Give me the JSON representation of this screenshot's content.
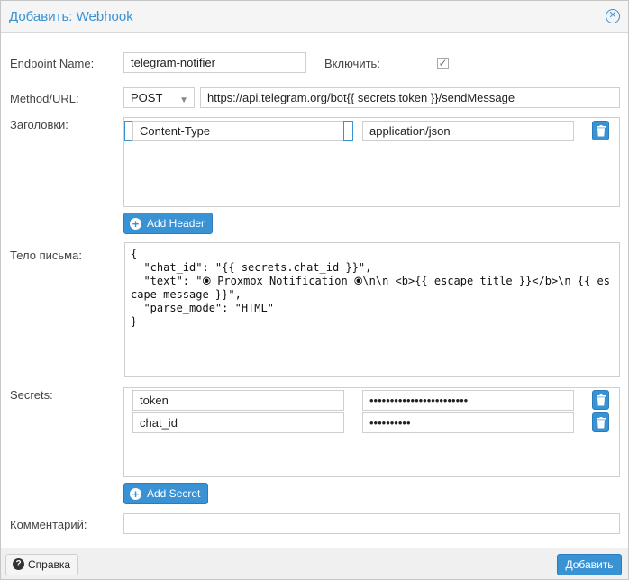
{
  "dialog": {
    "title": "Добавить: Webhook"
  },
  "form": {
    "endpoint_label": "Endpoint Name:",
    "endpoint_value": "telegram-notifier",
    "enable_label": "Включить:",
    "enable_checked": true,
    "method_label": "Method/URL:",
    "method_value": "POST",
    "url_value": "https://api.telegram.org/bot{{ secrets.token }}/sendMessage",
    "headers_label": "Заголовки:",
    "headers": [
      {
        "name": "Content-Type",
        "value": "application/json"
      }
    ],
    "add_header_label": "Add Header",
    "body_label": "Тело письма:",
    "body_text": "{\n  \"chat_id\": \"{{ secrets.chat_id }}\",\n  \"text\": \"🞊 Proxmox Notification 🞊\\n\\n <b>{{ escape title }}</b>\\n {{ escape message }}\",\n  \"parse_mode\": \"HTML\"\n}",
    "secrets_label": "Secrets:",
    "secrets": [
      {
        "name": "token",
        "value": "••••••••••••••••••••••••"
      },
      {
        "name": "chat_id",
        "value": "••••••••••"
      }
    ],
    "add_secret_label": "Add Secret",
    "comment_label": "Комментарий:",
    "comment_value": ""
  },
  "footer": {
    "help_label": "Справка",
    "submit_label": "Добавить"
  },
  "colors": {
    "accent": "#3892d4",
    "title": "#3892d4",
    "footer_bg": "#f0f0f0"
  },
  "icons": {
    "close": "close-icon",
    "checkbox": "check-icon",
    "trash": "trash-icon",
    "plus": "plus-circle-icon",
    "help": "question-circle-icon"
  }
}
